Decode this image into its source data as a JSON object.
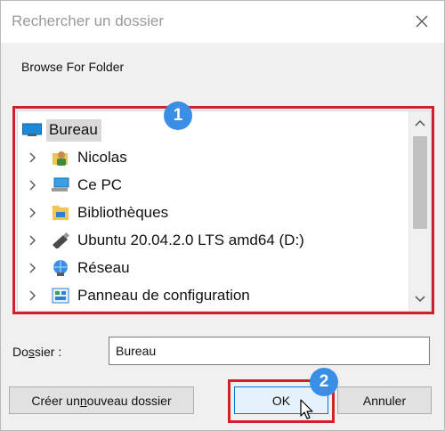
{
  "window": {
    "title": "Rechercher un dossier",
    "close_icon": "close-icon"
  },
  "description": "Browse For Folder",
  "tree": {
    "items": [
      {
        "label": "Bureau",
        "icon": "desktop-icon",
        "selected": true
      },
      {
        "label": "Nicolas",
        "icon": "user-folder-icon"
      },
      {
        "label": "Ce PC",
        "icon": "computer-icon"
      },
      {
        "label": "Bibliothèques",
        "icon": "libraries-icon"
      },
      {
        "label": "Ubuntu 20.04.2.0 LTS amd64 (D:)",
        "icon": "usb-drive-icon"
      },
      {
        "label": "Réseau",
        "icon": "network-icon"
      },
      {
        "label": "Panneau de configuration",
        "icon": "control-panel-icon"
      }
    ]
  },
  "annotations": {
    "badge1": "1",
    "badge2": "2"
  },
  "folder": {
    "label_prefix": "Do",
    "label_access": "s",
    "label_suffix": "sier :",
    "value": "Bureau"
  },
  "buttons": {
    "new_prefix": "Créer un ",
    "new_access": "n",
    "new_suffix": "ouveau dossier",
    "ok": "OK",
    "cancel": "Annuler"
  },
  "colors": {
    "highlight": "#d0202a",
    "badge": "#3a8ee6",
    "focus": "#0078d7"
  }
}
